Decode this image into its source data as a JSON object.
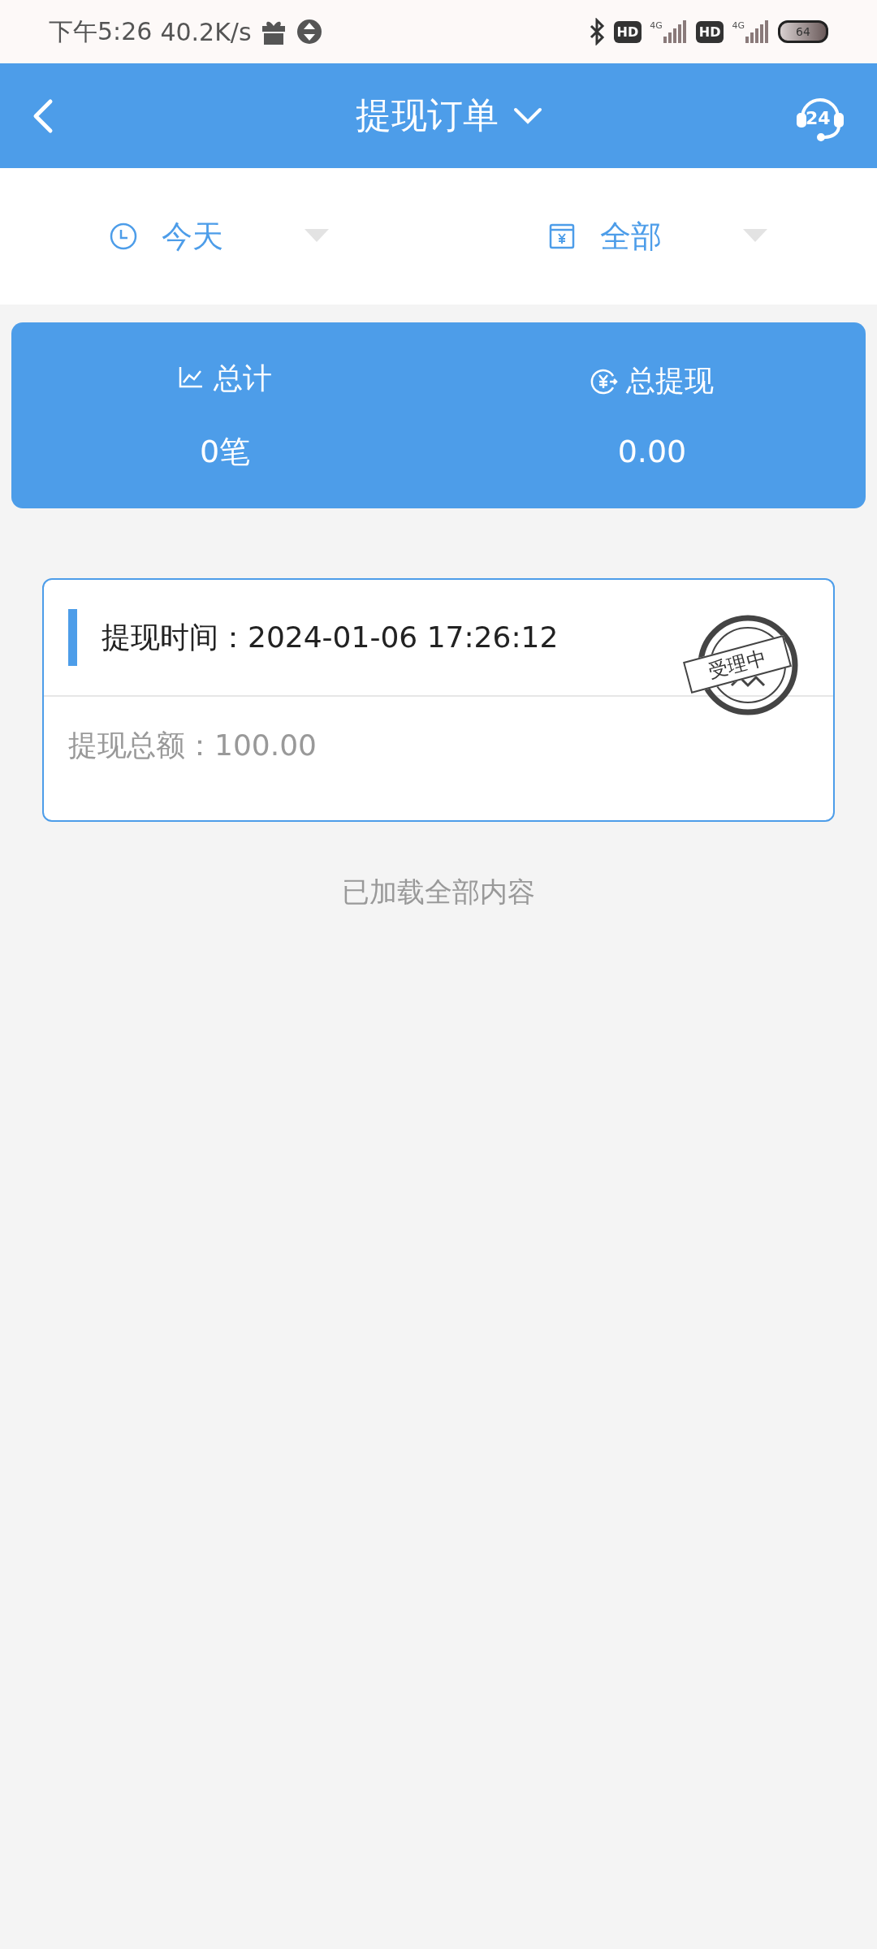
{
  "status_bar": {
    "time": "下午5:26",
    "speed": "40.2K/s",
    "hd_1": "HD",
    "network_1": "4G",
    "hd_2": "HD",
    "network_2": "4G",
    "battery": "64"
  },
  "header": {
    "title": "提现订单",
    "support_hours": "24"
  },
  "filters": [
    {
      "kind": "date",
      "label": "今天"
    },
    {
      "kind": "type",
      "label": "全部"
    }
  ],
  "summary": [
    {
      "kind": "count",
      "label": "总计",
      "value": "0笔"
    },
    {
      "kind": "amount",
      "label": "总提现",
      "value": "0.00"
    }
  ],
  "orders": [
    {
      "time_label": "提现时间：",
      "time": "2024-01-06 17:26:12",
      "amount_label": "提现总额：",
      "amount": "100.00",
      "stamp": "受理中"
    }
  ],
  "footer": "已加载全部内容"
}
